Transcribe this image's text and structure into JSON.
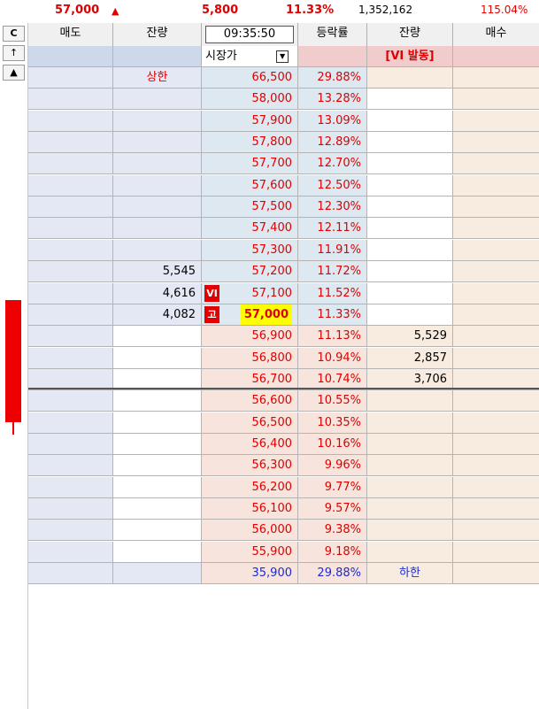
{
  "summary": {
    "price": "57,000",
    "arrow": "▲",
    "change": "5,800",
    "change_rate": "11.33%",
    "volume": "1,352,162",
    "volume_ratio": "115.04%"
  },
  "controls": {
    "btn_c": "C",
    "btn_up": "↑",
    "btn_tri": "▲"
  },
  "header": {
    "sell": "매도",
    "sell_qty": "잔량",
    "time": "09:35:50",
    "rate": "등락률",
    "buy_qty": "잔량",
    "buy": "매수"
  },
  "top_row": {
    "market_select": "시장가",
    "vi_status": "[VI 발동]"
  },
  "upper_limit_label": "상한",
  "lower_limit_label": "하한",
  "tags": {
    "vi": "VI",
    "high": "고"
  },
  "colors": {
    "accent_red": "#e00000",
    "lower_blue": "#1a2ad8",
    "current_highlight": "#ffff00"
  },
  "rows": [
    {
      "price": "66,500",
      "rate": "29.88%",
      "sell_qty": "상한",
      "buy_qty": ""
    },
    {
      "price": "58,000",
      "rate": "13.28%",
      "sell_qty": "",
      "buy_qty": ""
    },
    {
      "price": "57,900",
      "rate": "13.09%",
      "sell_qty": "",
      "buy_qty": ""
    },
    {
      "price": "57,800",
      "rate": "12.89%",
      "sell_qty": "",
      "buy_qty": ""
    },
    {
      "price": "57,700",
      "rate": "12.70%",
      "sell_qty": "",
      "buy_qty": ""
    },
    {
      "price": "57,600",
      "rate": "12.50%",
      "sell_qty": "",
      "buy_qty": ""
    },
    {
      "price": "57,500",
      "rate": "12.30%",
      "sell_qty": "",
      "buy_qty": ""
    },
    {
      "price": "57,400",
      "rate": "12.11%",
      "sell_qty": "",
      "buy_qty": ""
    },
    {
      "price": "57,300",
      "rate": "11.91%",
      "sell_qty": "",
      "buy_qty": ""
    },
    {
      "price": "57,200",
      "rate": "11.72%",
      "sell_qty": "5,545",
      "buy_qty": ""
    },
    {
      "price": "57,100",
      "rate": "11.52%",
      "sell_qty": "4,616",
      "buy_qty": ""
    },
    {
      "price": "57,000",
      "rate": "11.33%",
      "sell_qty": "4,082",
      "buy_qty": ""
    },
    {
      "price": "56,900",
      "rate": "11.13%",
      "sell_qty": "",
      "buy_qty": "5,529"
    },
    {
      "price": "56,800",
      "rate": "10.94%",
      "sell_qty": "",
      "buy_qty": "2,857"
    },
    {
      "price": "56,700",
      "rate": "10.74%",
      "sell_qty": "",
      "buy_qty": "3,706"
    },
    {
      "price": "56,600",
      "rate": "10.55%",
      "sell_qty": "",
      "buy_qty": ""
    },
    {
      "price": "56,500",
      "rate": "10.35%",
      "sell_qty": "",
      "buy_qty": ""
    },
    {
      "price": "56,400",
      "rate": "10.16%",
      "sell_qty": "",
      "buy_qty": ""
    },
    {
      "price": "56,300",
      "rate": "9.96%",
      "sell_qty": "",
      "buy_qty": ""
    },
    {
      "price": "56,200",
      "rate": "9.77%",
      "sell_qty": "",
      "buy_qty": ""
    },
    {
      "price": "56,100",
      "rate": "9.57%",
      "sell_qty": "",
      "buy_qty": ""
    },
    {
      "price": "56,000",
      "rate": "9.38%",
      "sell_qty": "",
      "buy_qty": ""
    },
    {
      "price": "55,900",
      "rate": "9.18%",
      "sell_qty": "",
      "buy_qty": ""
    },
    {
      "price": "35,900",
      "rate": "29.88%",
      "sell_qty": "",
      "buy_qty": "하한"
    }
  ]
}
